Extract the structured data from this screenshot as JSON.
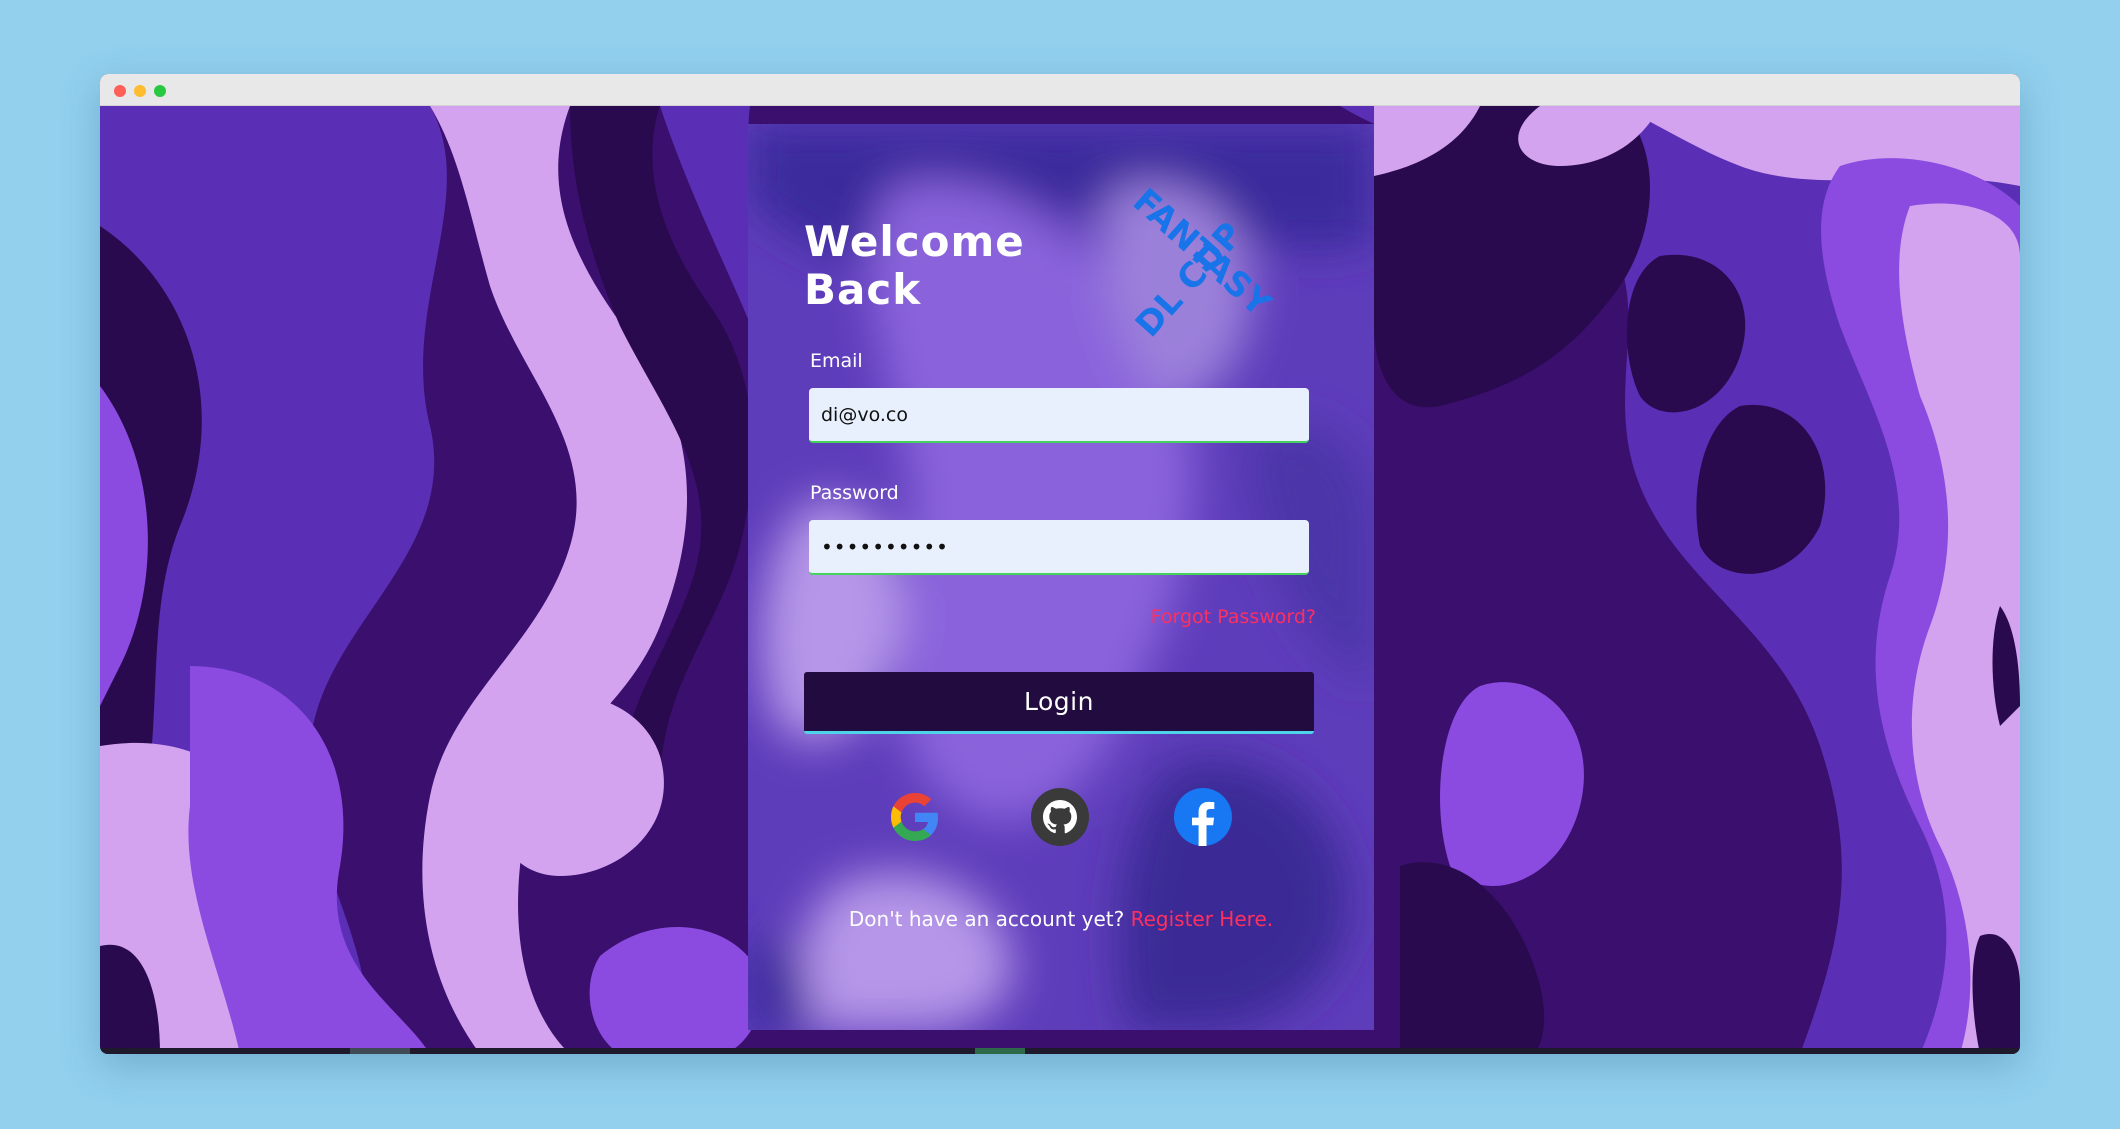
{
  "login": {
    "title_line1": "Welcome",
    "title_line2": "Back",
    "logo": {
      "word1": "FANTASY",
      "word2": "DL CUP"
    },
    "email": {
      "label": "Email",
      "value": "di@vo.co"
    },
    "password": {
      "label": "Password",
      "value": "••••••••••"
    },
    "forgot_label": "Forgot Password?",
    "login_label": "Login",
    "social": [
      "google-icon",
      "github-icon",
      "facebook-icon"
    ],
    "register_prompt": "Don't have an account yet?",
    "register_link": "Register Here."
  },
  "colors": {
    "accent_pink": "#ff2f5e",
    "button_dark": "#210b3f",
    "input_bg": "#e9f0fd",
    "input_focus_border": "#44d15c",
    "page_background": "#92d0ee",
    "logo_blue": "#1874e8"
  }
}
